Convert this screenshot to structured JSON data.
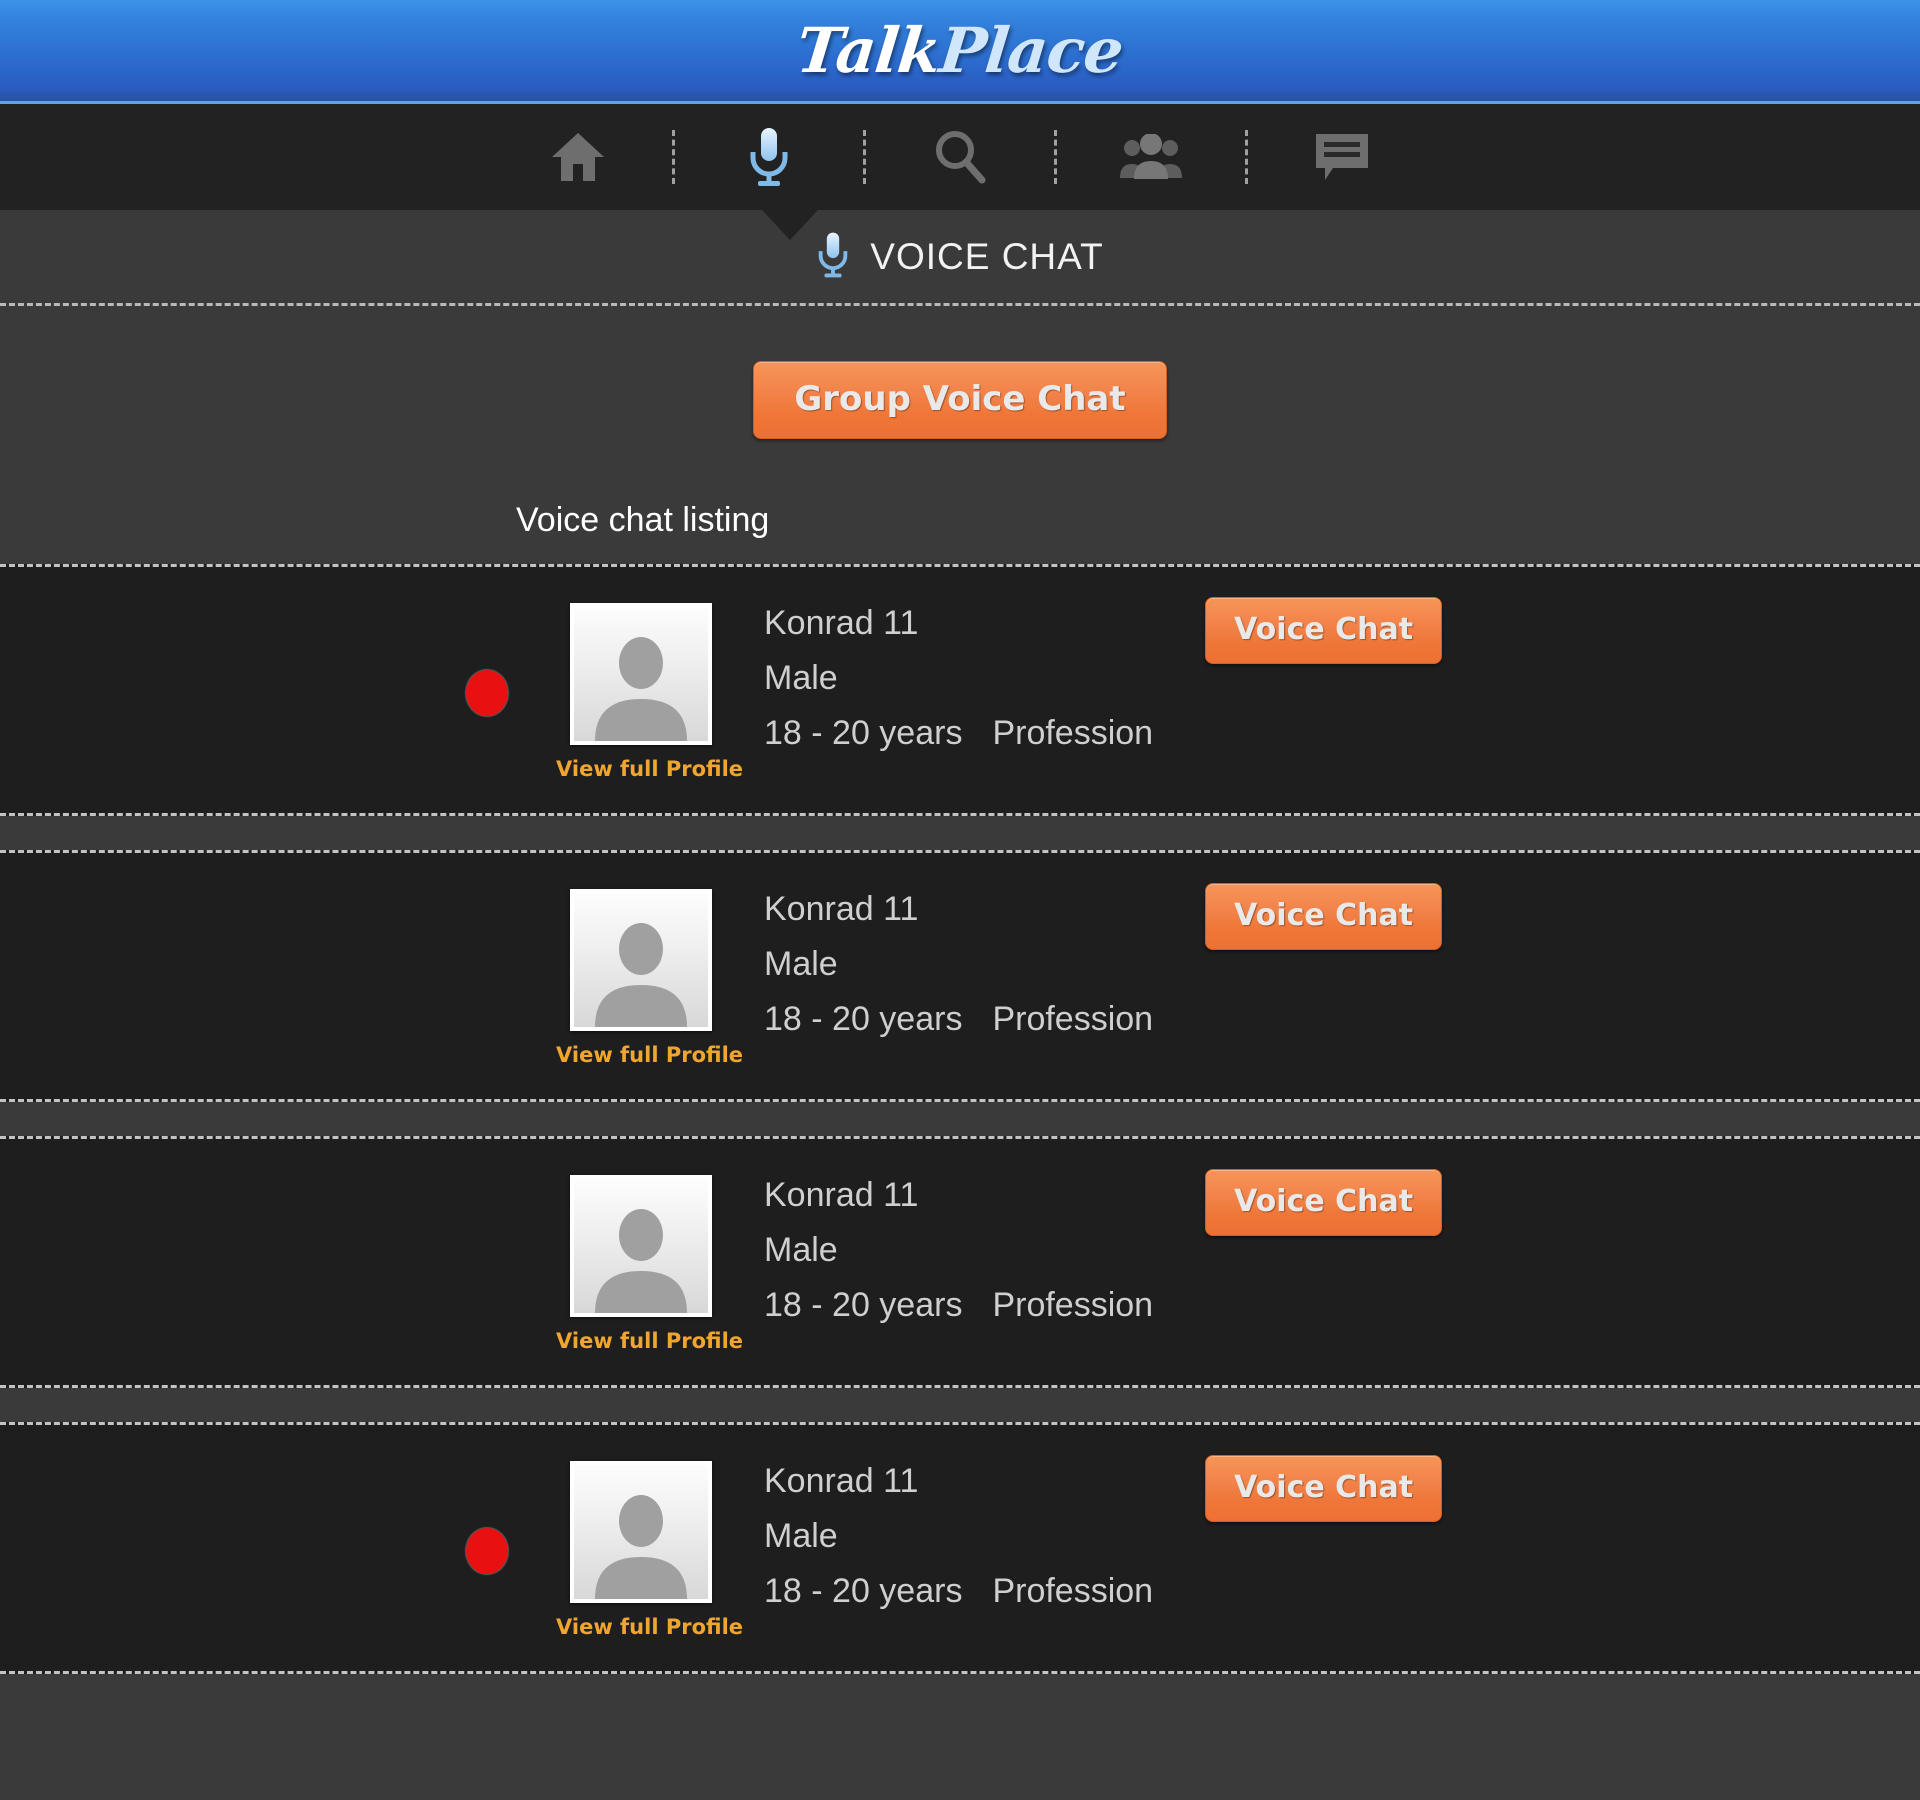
{
  "header": {
    "logo_word1": "Talk",
    "logo_word2": "Place",
    "brand_blue": "#2c6fd0",
    "accent_orange": "#ee7034"
  },
  "nav": {
    "items": [
      {
        "icon": "home-icon",
        "label": "Home",
        "active": false
      },
      {
        "icon": "microphone-icon",
        "label": "Voice Chat",
        "active": true
      },
      {
        "icon": "search-icon",
        "label": "Search",
        "active": false
      },
      {
        "icon": "people-icon",
        "label": "People",
        "active": false
      },
      {
        "icon": "chat-bubble-icon",
        "label": "Messages",
        "active": false
      }
    ]
  },
  "section": {
    "icon": "microphone-icon",
    "title": "VOICE CHAT"
  },
  "actions": {
    "group_voice_chat_label": "Group Voice Chat"
  },
  "listing": {
    "heading": "Voice chat listing",
    "profile_link_label": "View full Profile",
    "voice_chat_button_label": "Voice Chat",
    "rows": [
      {
        "name": "Konrad 11",
        "gender": "Male",
        "age": "18 - 20 years",
        "profession": "Profession",
        "online": true,
        "status_color": "#e81010",
        "avatar": "person-placeholder-icon"
      },
      {
        "name": "Konrad 11",
        "gender": "Male",
        "age": "18 - 20 years",
        "profession": "Profession",
        "online": false,
        "status_color": "#e81010",
        "avatar": "person-placeholder-icon"
      },
      {
        "name": "Konrad 11",
        "gender": "Male",
        "age": "18 - 20 years",
        "profession": "Profession",
        "online": false,
        "status_color": "#e81010",
        "avatar": "person-placeholder-icon"
      },
      {
        "name": "Konrad 11",
        "gender": "Male",
        "age": "18 - 20 years",
        "profession": "Profession",
        "online": true,
        "status_color": "#e81010",
        "avatar": "person-placeholder-icon"
      }
    ]
  }
}
